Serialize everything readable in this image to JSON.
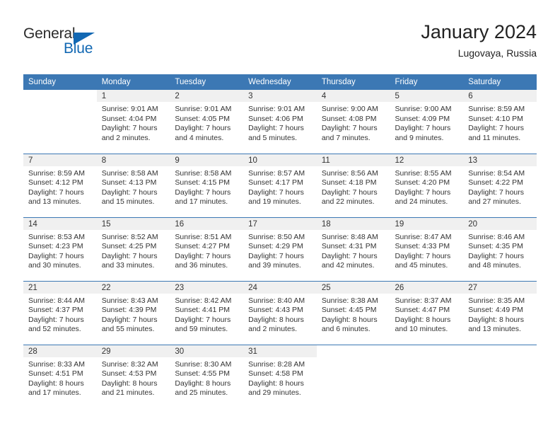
{
  "brand": {
    "name_part1": "General",
    "name_part2": "Blue",
    "accent_color": "#1268b3"
  },
  "header": {
    "title": "January 2024",
    "subtitle": "Lugovaya, Russia"
  },
  "theme": {
    "header_row_color": "#3c78b4",
    "daynum_band_color": "#f0f0f0",
    "text_color": "#333333"
  },
  "weekday_headers": [
    "Sunday",
    "Monday",
    "Tuesday",
    "Wednesday",
    "Thursday",
    "Friday",
    "Saturday"
  ],
  "weeks": [
    [
      {
        "day": "",
        "blank": true,
        "lines": []
      },
      {
        "day": "1",
        "lines": [
          "Sunrise: 9:01 AM",
          "Sunset: 4:04 PM",
          "Daylight: 7 hours",
          "and 2 minutes."
        ]
      },
      {
        "day": "2",
        "lines": [
          "Sunrise: 9:01 AM",
          "Sunset: 4:05 PM",
          "Daylight: 7 hours",
          "and 4 minutes."
        ]
      },
      {
        "day": "3",
        "lines": [
          "Sunrise: 9:01 AM",
          "Sunset: 4:06 PM",
          "Daylight: 7 hours",
          "and 5 minutes."
        ]
      },
      {
        "day": "4",
        "lines": [
          "Sunrise: 9:00 AM",
          "Sunset: 4:08 PM",
          "Daylight: 7 hours",
          "and 7 minutes."
        ]
      },
      {
        "day": "5",
        "lines": [
          "Sunrise: 9:00 AM",
          "Sunset: 4:09 PM",
          "Daylight: 7 hours",
          "and 9 minutes."
        ]
      },
      {
        "day": "6",
        "lines": [
          "Sunrise: 8:59 AM",
          "Sunset: 4:10 PM",
          "Daylight: 7 hours",
          "and 11 minutes."
        ]
      }
    ],
    [
      {
        "day": "7",
        "lines": [
          "Sunrise: 8:59 AM",
          "Sunset: 4:12 PM",
          "Daylight: 7 hours",
          "and 13 minutes."
        ]
      },
      {
        "day": "8",
        "lines": [
          "Sunrise: 8:58 AM",
          "Sunset: 4:13 PM",
          "Daylight: 7 hours",
          "and 15 minutes."
        ]
      },
      {
        "day": "9",
        "lines": [
          "Sunrise: 8:58 AM",
          "Sunset: 4:15 PM",
          "Daylight: 7 hours",
          "and 17 minutes."
        ]
      },
      {
        "day": "10",
        "lines": [
          "Sunrise: 8:57 AM",
          "Sunset: 4:17 PM",
          "Daylight: 7 hours",
          "and 19 minutes."
        ]
      },
      {
        "day": "11",
        "lines": [
          "Sunrise: 8:56 AM",
          "Sunset: 4:18 PM",
          "Daylight: 7 hours",
          "and 22 minutes."
        ]
      },
      {
        "day": "12",
        "lines": [
          "Sunrise: 8:55 AM",
          "Sunset: 4:20 PM",
          "Daylight: 7 hours",
          "and 24 minutes."
        ]
      },
      {
        "day": "13",
        "lines": [
          "Sunrise: 8:54 AM",
          "Sunset: 4:22 PM",
          "Daylight: 7 hours",
          "and 27 minutes."
        ]
      }
    ],
    [
      {
        "day": "14",
        "lines": [
          "Sunrise: 8:53 AM",
          "Sunset: 4:23 PM",
          "Daylight: 7 hours",
          "and 30 minutes."
        ]
      },
      {
        "day": "15",
        "lines": [
          "Sunrise: 8:52 AM",
          "Sunset: 4:25 PM",
          "Daylight: 7 hours",
          "and 33 minutes."
        ]
      },
      {
        "day": "16",
        "lines": [
          "Sunrise: 8:51 AM",
          "Sunset: 4:27 PM",
          "Daylight: 7 hours",
          "and 36 minutes."
        ]
      },
      {
        "day": "17",
        "lines": [
          "Sunrise: 8:50 AM",
          "Sunset: 4:29 PM",
          "Daylight: 7 hours",
          "and 39 minutes."
        ]
      },
      {
        "day": "18",
        "lines": [
          "Sunrise: 8:48 AM",
          "Sunset: 4:31 PM",
          "Daylight: 7 hours",
          "and 42 minutes."
        ]
      },
      {
        "day": "19",
        "lines": [
          "Sunrise: 8:47 AM",
          "Sunset: 4:33 PM",
          "Daylight: 7 hours",
          "and 45 minutes."
        ]
      },
      {
        "day": "20",
        "lines": [
          "Sunrise: 8:46 AM",
          "Sunset: 4:35 PM",
          "Daylight: 7 hours",
          "and 48 minutes."
        ]
      }
    ],
    [
      {
        "day": "21",
        "lines": [
          "Sunrise: 8:44 AM",
          "Sunset: 4:37 PM",
          "Daylight: 7 hours",
          "and 52 minutes."
        ]
      },
      {
        "day": "22",
        "lines": [
          "Sunrise: 8:43 AM",
          "Sunset: 4:39 PM",
          "Daylight: 7 hours",
          "and 55 minutes."
        ]
      },
      {
        "day": "23",
        "lines": [
          "Sunrise: 8:42 AM",
          "Sunset: 4:41 PM",
          "Daylight: 7 hours",
          "and 59 minutes."
        ]
      },
      {
        "day": "24",
        "lines": [
          "Sunrise: 8:40 AM",
          "Sunset: 4:43 PM",
          "Daylight: 8 hours",
          "and 2 minutes."
        ]
      },
      {
        "day": "25",
        "lines": [
          "Sunrise: 8:38 AM",
          "Sunset: 4:45 PM",
          "Daylight: 8 hours",
          "and 6 minutes."
        ]
      },
      {
        "day": "26",
        "lines": [
          "Sunrise: 8:37 AM",
          "Sunset: 4:47 PM",
          "Daylight: 8 hours",
          "and 10 minutes."
        ]
      },
      {
        "day": "27",
        "lines": [
          "Sunrise: 8:35 AM",
          "Sunset: 4:49 PM",
          "Daylight: 8 hours",
          "and 13 minutes."
        ]
      }
    ],
    [
      {
        "day": "28",
        "lines": [
          "Sunrise: 8:33 AM",
          "Sunset: 4:51 PM",
          "Daylight: 8 hours",
          "and 17 minutes."
        ]
      },
      {
        "day": "29",
        "lines": [
          "Sunrise: 8:32 AM",
          "Sunset: 4:53 PM",
          "Daylight: 8 hours",
          "and 21 minutes."
        ]
      },
      {
        "day": "30",
        "lines": [
          "Sunrise: 8:30 AM",
          "Sunset: 4:55 PM",
          "Daylight: 8 hours",
          "and 25 minutes."
        ]
      },
      {
        "day": "31",
        "lines": [
          "Sunrise: 8:28 AM",
          "Sunset: 4:58 PM",
          "Daylight: 8 hours",
          "and 29 minutes."
        ]
      },
      {
        "day": "",
        "blank": true,
        "lines": []
      },
      {
        "day": "",
        "blank": true,
        "lines": []
      },
      {
        "day": "",
        "blank": true,
        "lines": []
      }
    ]
  ]
}
